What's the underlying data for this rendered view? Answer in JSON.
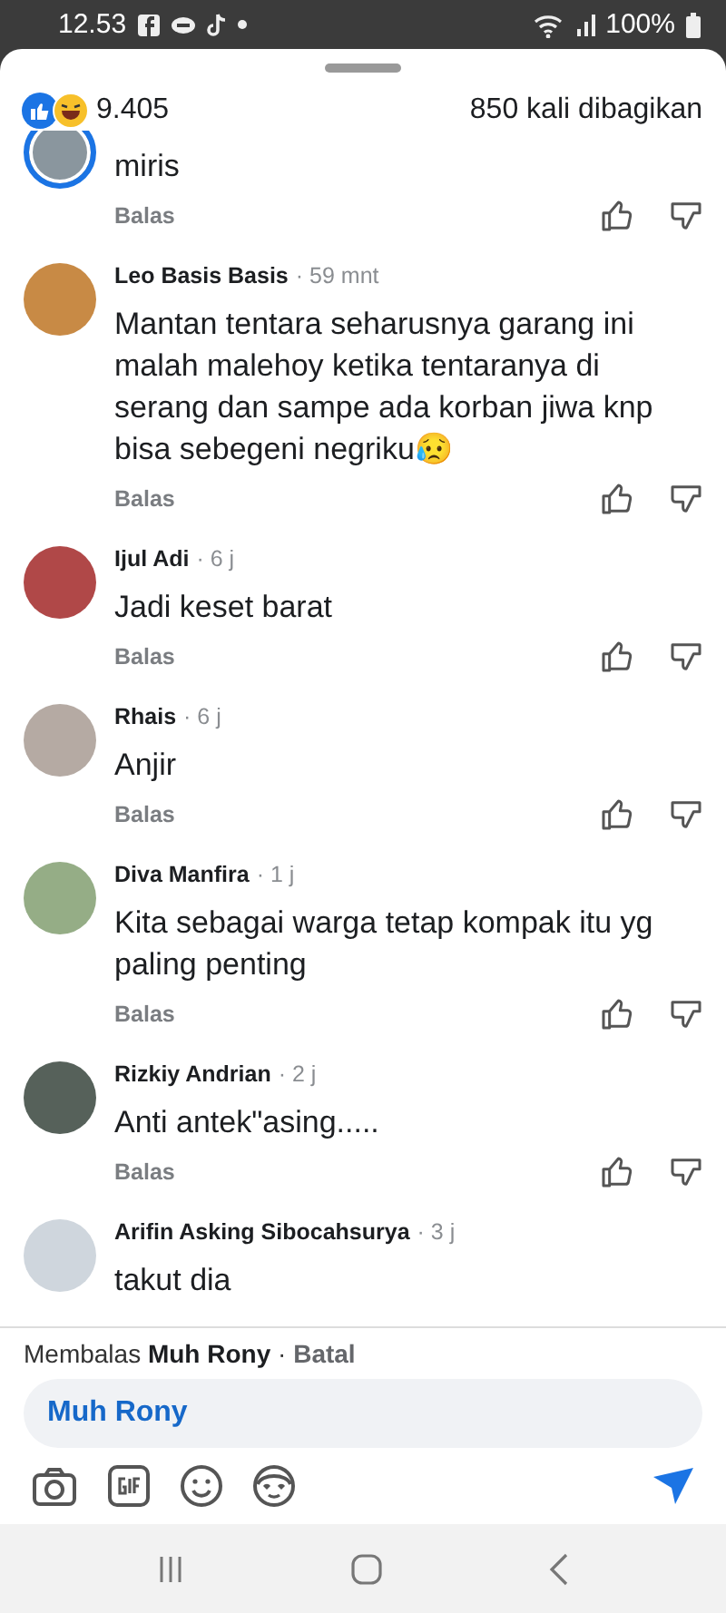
{
  "status_bar": {
    "time": "12.53",
    "battery": "100%"
  },
  "reactions": {
    "count": "9.405",
    "shares": "850 kali dibagikan"
  },
  "comments": [
    {
      "text": "miris",
      "reply": "Balas",
      "has_story": true
    },
    {
      "author": "Leo Basis Basis",
      "time": "· 59 mnt",
      "text": "Mantan tentara seharusnya garang ini malah malehoy ketika tentaranya di serang dan sampe ada korban jiwa knp bisa sebegeni negriku😥",
      "reply": "Balas",
      "has_story": false
    },
    {
      "author": "Ijul Adi",
      "time": "· 6 j",
      "text": "Jadi keset barat",
      "reply": "Balas",
      "has_story": false
    },
    {
      "author": "Rhais",
      "time": "· 6 j",
      "text": "Anjir",
      "reply": "Balas",
      "has_story": false
    },
    {
      "author": "Diva Manfira",
      "time": "· 1 j",
      "text": "Kita sebagai warga tetap kompak itu yg paling penting",
      "reply": "Balas",
      "has_story": false
    },
    {
      "author": "Rizkiy Andrian",
      "time": "· 2 j",
      "text": "Anti antek\"asing.....",
      "reply": "Balas",
      "has_story": false
    },
    {
      "author": "Arifin Asking Sibocahsurya",
      "time": "· 3 j",
      "text": "takut dia",
      "has_story": false
    }
  ],
  "composer": {
    "replying_label": "Membalas",
    "replying_to": "Muh Rony",
    "separator": "·",
    "cancel": "Batal",
    "value": "Muh Rony"
  }
}
